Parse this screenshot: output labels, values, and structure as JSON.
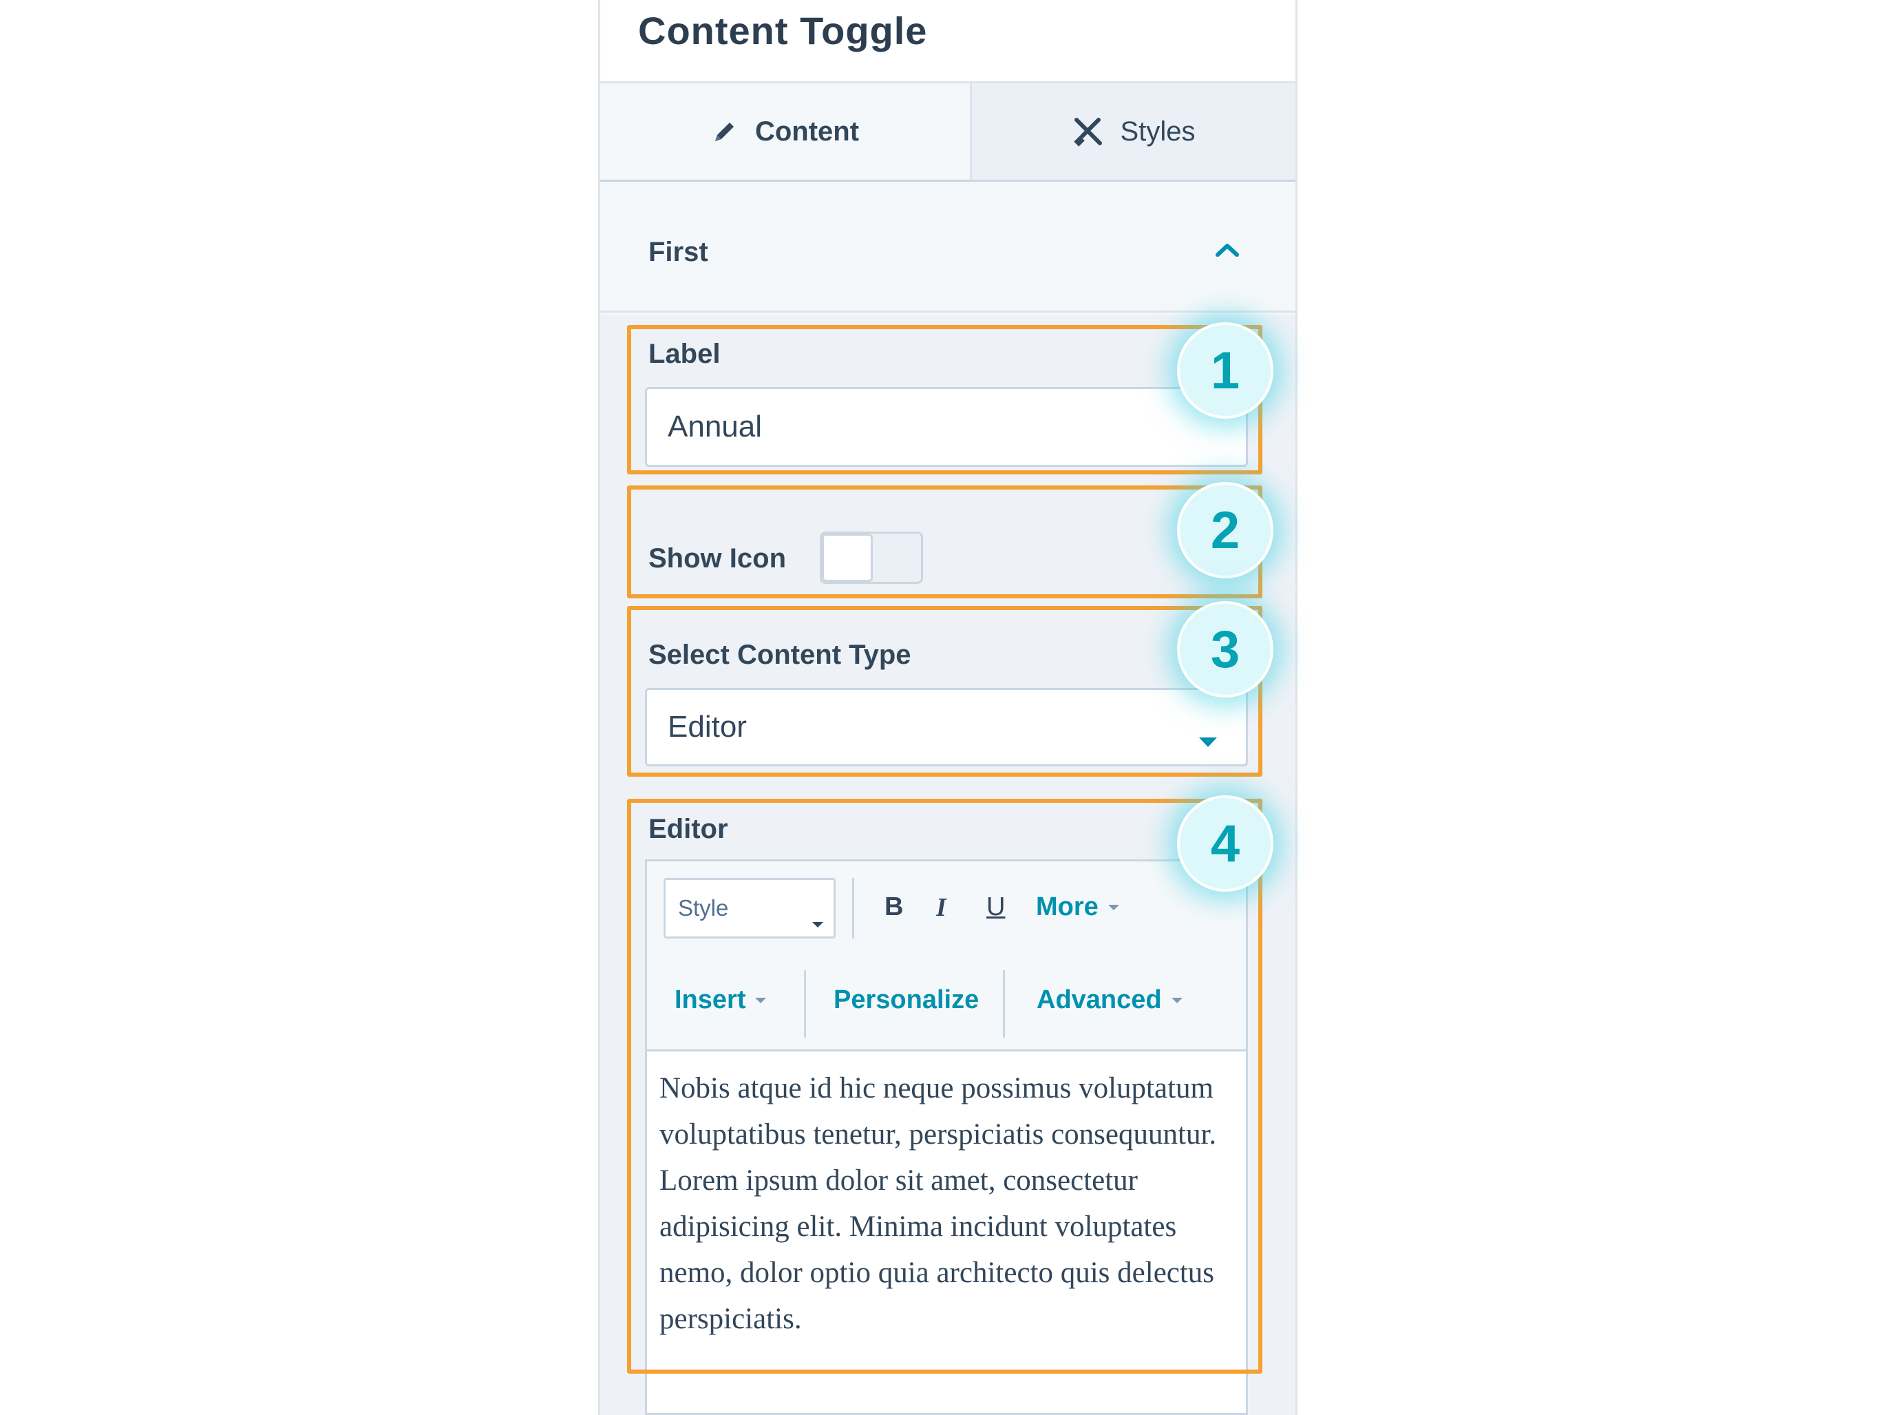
{
  "panel": {
    "title": "Content Toggle"
  },
  "tabs": [
    {
      "label": "Content",
      "icon": "pencil-icon",
      "active": true
    },
    {
      "label": "Styles",
      "icon": "styles-icon",
      "active": false
    }
  ],
  "section": {
    "title": "First",
    "expanded": true
  },
  "fields": {
    "label": {
      "label": "Label",
      "value": "Annual"
    },
    "show_icon": {
      "label": "Show Icon",
      "on": false
    },
    "content_type": {
      "label": "Select Content Type",
      "value": "Editor"
    },
    "editor": {
      "label": "Editor",
      "toolbar": {
        "style_placeholder": "Style",
        "bold": "B",
        "italic": "I",
        "underline": "U",
        "more": "More",
        "insert": "Insert",
        "personalize": "Personalize",
        "advanced": "Advanced"
      },
      "body": "Nobis atque id hic neque possimus voluptatum voluptatibus tenetur, perspiciatis consequuntur. Lorem ipsum dolor sit amet, consectetur adipisicing elit. Minima incidunt voluptates nemo, dolor optio quia architecto quis delectus perspiciatis."
    }
  },
  "callouts": [
    "1",
    "2",
    "3",
    "4"
  ],
  "colors": {
    "highlight": "#f5a033",
    "accent": "#0091ae",
    "badge_text": "#05a3b4",
    "badge_fill": "#dcf8fb"
  }
}
